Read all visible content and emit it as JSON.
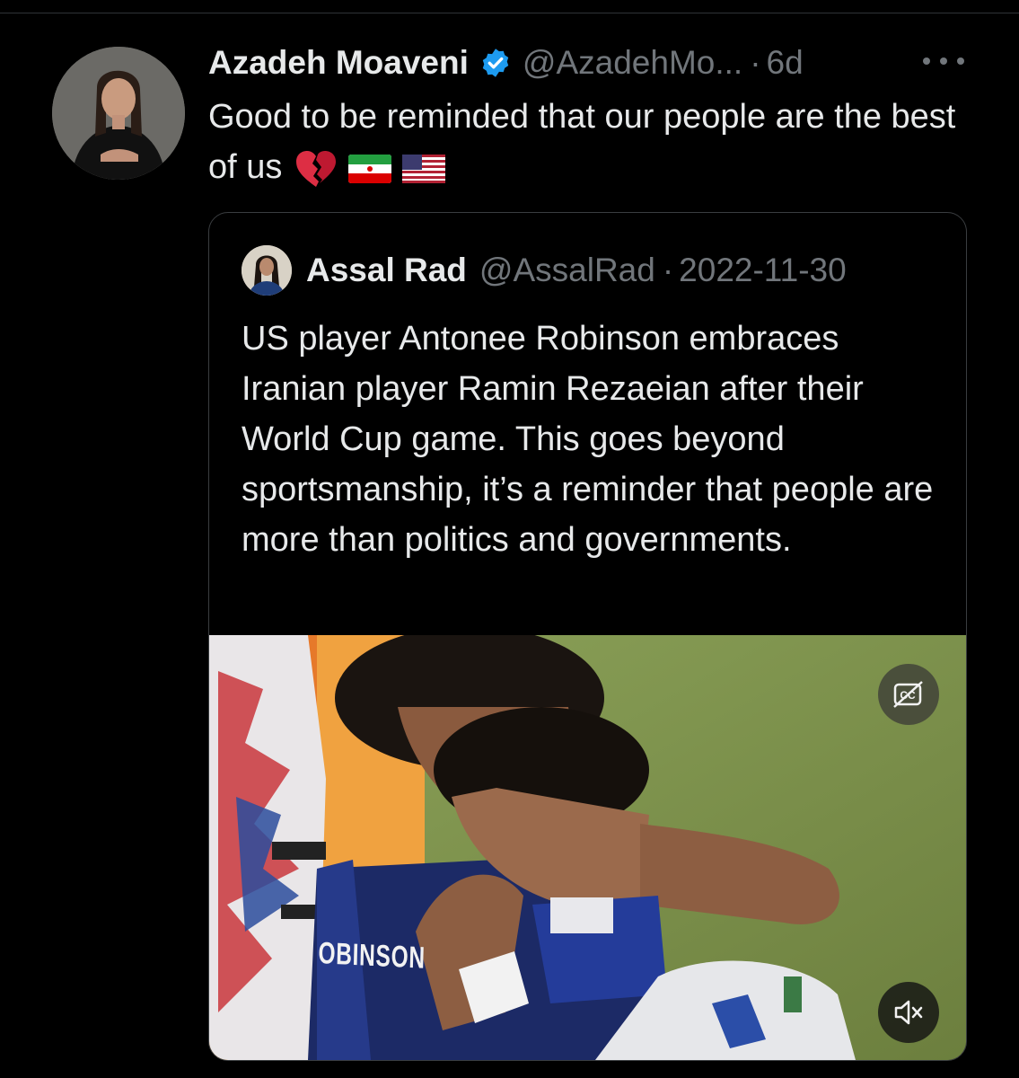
{
  "tweet": {
    "author_name": "Azadeh Moaveni",
    "author_handle": "@AzadehMo...",
    "separator": "·",
    "time": "6d",
    "text": "Good to be reminded that our people are the best of us",
    "emojis": [
      "broken-heart-emoji",
      "iran-flag-emoji",
      "us-flag-emoji"
    ],
    "more_icon": "more-dots-icon",
    "verified_icon": "verified-badge-icon",
    "verified_color": "#1d9bf0"
  },
  "quoted_tweet": {
    "author_name": "Assal Rad",
    "author_handle": "@AssalRad",
    "separator": "·",
    "date": "2022-11-30",
    "text": "US player Antonee Robinson embraces Iranian player Ramin Rezaeian after their World Cup game. This goes beyond sportsmanship, it’s a reminder that people are more than politics and governments.",
    "video": {
      "jersey_text": "OBINSON",
      "cc_icon": "closed-captions-off-icon",
      "mute_icon": "volume-muted-icon"
    }
  },
  "colors": {
    "background": "#000000",
    "text_primary": "#e7e9ea",
    "text_secondary": "#71767b",
    "border": "#3a3d40"
  }
}
